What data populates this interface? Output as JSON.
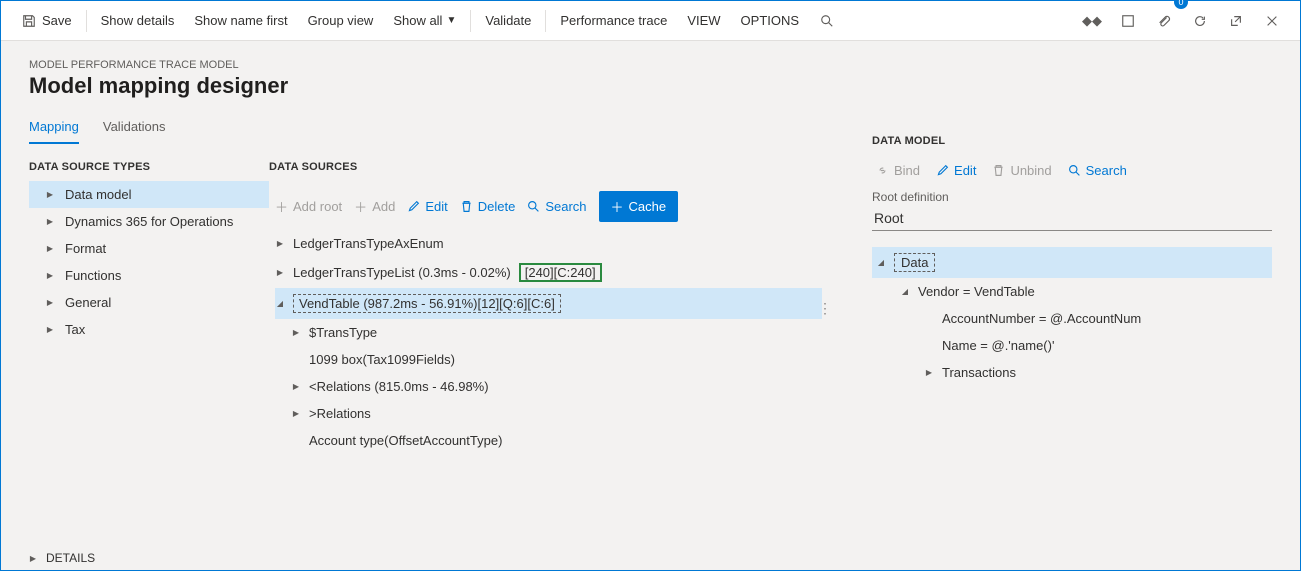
{
  "toolbar": {
    "save": "Save",
    "showDetails": "Show details",
    "showNameFirst": "Show name first",
    "groupView": "Group view",
    "showAll": "Show all",
    "validate": "Validate",
    "perfTrace": "Performance trace",
    "view": "VIEW",
    "options": "OPTIONS",
    "badge": "0"
  },
  "breadcrumb": "MODEL PERFORMANCE TRACE MODEL",
  "pageTitle": "Model mapping designer",
  "tabs": {
    "mapping": "Mapping",
    "validations": "Validations"
  },
  "dataSourceTypes": {
    "label": "DATA SOURCE TYPES",
    "items": [
      "Data model",
      "Dynamics 365 for Operations",
      "Format",
      "Functions",
      "General",
      "Tax"
    ]
  },
  "dataSources": {
    "label": "DATA SOURCES",
    "toolbar": {
      "addRoot": "Add root",
      "add": "Add",
      "edit": "Edit",
      "delete": "Delete",
      "search": "Search",
      "cache": "Cache"
    },
    "row1": "LedgerTransTypeAxEnum",
    "row2_main": "LedgerTransTypeList (0.3ms - 0.02%)",
    "row2_box": "[240][C:240]",
    "row3": "VendTable (987.2ms - 56.91%)[12][Q:6][C:6]",
    "row4": "$TransType",
    "row5": "1099 box(Tax1099Fields)",
    "row6": "<Relations (815.0ms - 46.98%)",
    "row7": ">Relations",
    "row8": "Account type(OffsetAccountType)"
  },
  "dataModel": {
    "label": "DATA MODEL",
    "toolbar": {
      "bind": "Bind",
      "edit": "Edit",
      "unbind": "Unbind",
      "search": "Search"
    },
    "rootDefLabel": "Root definition",
    "rootDefValue": "Root",
    "r1": "Data",
    "r2": "Vendor = VendTable",
    "r3": "AccountNumber = @.AccountNum",
    "r4": "Name = @.'name()'",
    "r5": "Transactions"
  },
  "details": "DETAILS"
}
